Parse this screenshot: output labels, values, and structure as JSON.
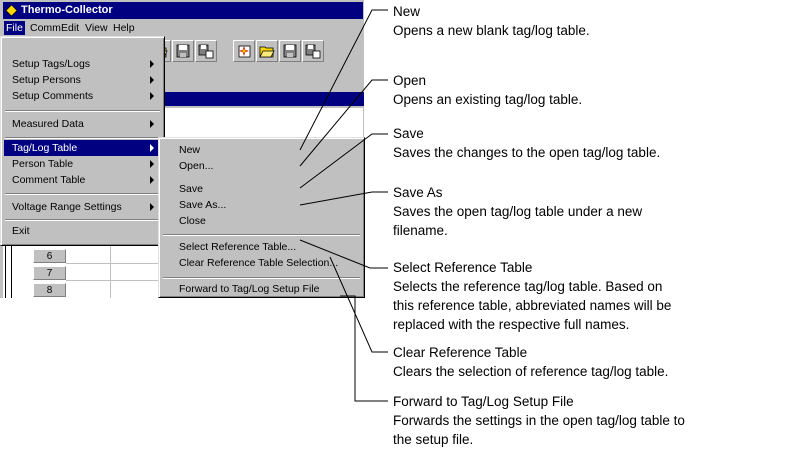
{
  "window": {
    "title": "Thermo-Collector"
  },
  "menubar": [
    {
      "label": "File"
    },
    {
      "label": "Comm"
    },
    {
      "label": "Edit"
    },
    {
      "label": "View"
    },
    {
      "label": "Help"
    }
  ],
  "file_menu": {
    "items": [
      {
        "label": "Setup Tags/Logs",
        "submenu": true
      },
      {
        "label": "Setup Persons",
        "submenu": true
      },
      {
        "label": "Setup Comments",
        "submenu": true
      },
      {
        "label": "Measured Data",
        "submenu": true
      },
      {
        "label": "Tag/Log Table",
        "submenu": true,
        "highlighted": true
      },
      {
        "label": "Person Table",
        "submenu": true
      },
      {
        "label": "Comment Table",
        "submenu": true
      },
      {
        "label": "Voltage Range Settings",
        "submenu": true
      },
      {
        "label": "Exit",
        "submenu": false
      }
    ]
  },
  "submenu": {
    "items": [
      {
        "label": "New"
      },
      {
        "label": "Open..."
      },
      {
        "label": "Save"
      },
      {
        "label": "Save As..."
      },
      {
        "label": "Close"
      },
      {
        "label": "Select Reference Table..."
      },
      {
        "label": "Clear Reference Table Selection..."
      },
      {
        "label": "Forward to Tag/Log Setup File"
      }
    ]
  },
  "grid_rows": [
    "6",
    "7",
    "8"
  ],
  "callouts": [
    {
      "title": "New",
      "desc": [
        "Opens a new blank tag/log table."
      ]
    },
    {
      "title": "Open",
      "desc": [
        "Opens an existing tag/log table."
      ]
    },
    {
      "title": "Save",
      "desc": [
        "Saves the changes to the open tag/log table."
      ]
    },
    {
      "title": "Save As",
      "desc": [
        "Saves the open tag/log table under a new",
        "filename."
      ]
    },
    {
      "title": "Select Reference Table",
      "desc": [
        "Selects the reference tag/log table.  Based on",
        "this reference table, abbreviated names will be",
        "replaced with the respective full names."
      ]
    },
    {
      "title": "Clear Reference Table",
      "desc": [
        "Clears the selection of reference tag/log table."
      ]
    },
    {
      "title": "Forward to Tag/Log Setup File",
      "desc": [
        "Forwards the settings in the open tag/log table to",
        "the setup file."
      ]
    }
  ],
  "colors": {
    "title_bar": "#000080",
    "highlight": "#000080",
    "face": "#c0c0c0",
    "app_icon": "#ffd700"
  }
}
